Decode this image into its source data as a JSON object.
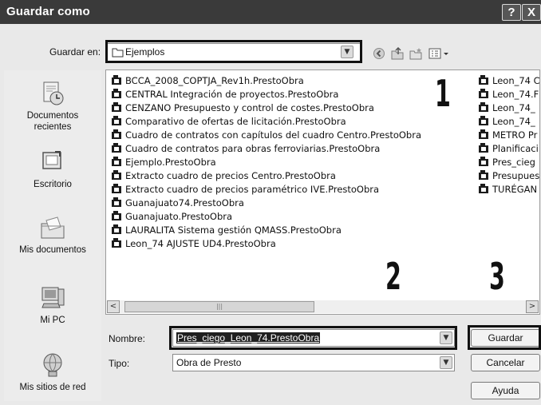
{
  "window": {
    "title": "Guardar como",
    "help_glyph": "?",
    "close_glyph": "X"
  },
  "location": {
    "label": "Guardar en:",
    "value": "Ejemplos"
  },
  "toolbar_icons": [
    "back-icon",
    "up-folder-icon",
    "new-folder-icon",
    "views-menu-icon"
  ],
  "places": [
    {
      "label_lines": [
        "Documentos",
        "recientes"
      ],
      "icon": "recent-documents-icon"
    },
    {
      "label_lines": [
        "Escritorio"
      ],
      "icon": "desktop-icon"
    },
    {
      "label_lines": [
        "Mis documentos"
      ],
      "icon": "my-documents-icon"
    },
    {
      "label_lines": [
        "Mi PC"
      ],
      "icon": "my-computer-icon"
    },
    {
      "label_lines": [
        "Mis sitios de red"
      ],
      "icon": "network-places-icon"
    }
  ],
  "files_col1": [
    "BCCA_2008_COPTJA_Rev1h.PrestoObra",
    "CENTRAL Integración de proyectos.PrestoObra",
    "CENZANO Presupuesto y control de costes.PrestoObra",
    "Comparativo de ofertas de licitación.PrestoObra",
    "Cuadro de contratos con capítulos del cuadro Centro.PrestoObra",
    "Cuadro de contratos para obras ferroviarias.PrestoObra",
    "Ejemplo.PrestoObra",
    "Extracto cuadro de precios Centro.PrestoObra",
    "Extracto cuadro de precios paramétrico IVE.PrestoObra",
    "Guanajuato74.PrestoObra",
    "Guanajuato.PrestoObra",
    "LAURALITA Sistema gestión QMASS.PrestoObra",
    "Leon_74 AJUSTE UD4.PrestoObra"
  ],
  "files_col2": [
    "Leon_74 C",
    "Leon_74.F",
    "Leon_74_",
    "Leon_74_",
    "METRO Pr",
    "Planificaci",
    "Pres_cieg",
    "Presupues",
    "TURÉGAN"
  ],
  "callouts": [
    "1",
    "2",
    "3"
  ],
  "filename": {
    "label": "Nombre:",
    "value": "Pres_ciego_Leon_74.PrestoObra"
  },
  "filetype": {
    "label": "Tipo:",
    "value": "Obra de Presto"
  },
  "buttons": {
    "save": "Guardar",
    "cancel": "Cancelar",
    "help": "Ayuda"
  },
  "scrollbar": {
    "left_arrow": "<",
    "right_arrow": ">",
    "grip": "|||"
  }
}
